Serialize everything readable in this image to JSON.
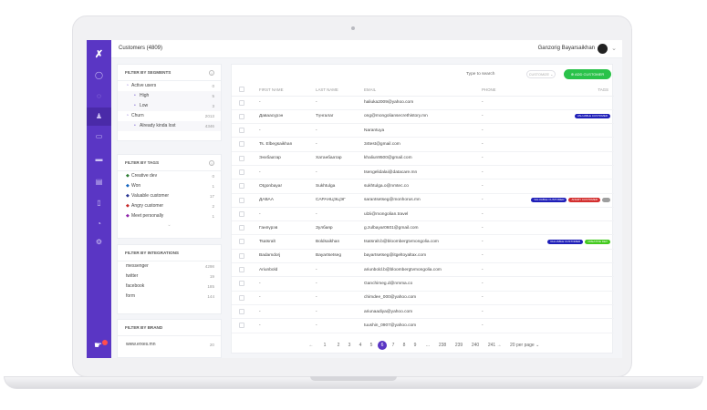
{
  "header": {
    "title": "Customers (4809)",
    "user_name": "Ganzorig Bayarsaikhan"
  },
  "segments": {
    "heading": "FILTER BY SEGMENTS",
    "items": [
      {
        "label": "Active users",
        "count": "0"
      },
      {
        "label": "High",
        "count": "5"
      },
      {
        "label": "Low",
        "count": "3"
      },
      {
        "label": "Churn",
        "count": "2013"
      },
      {
        "label": "Already kinda lost",
        "count": "4346"
      }
    ]
  },
  "tags_filter": {
    "heading": "FILTER BY TAGS",
    "items": [
      {
        "label": "Creative dev",
        "count": "0",
        "color": "#2e7d32"
      },
      {
        "label": "Won",
        "count": "1",
        "color": "#1565c0"
      },
      {
        "label": "Valuable customer",
        "count": "17",
        "color": "#283593"
      },
      {
        "label": "Angry customer",
        "count": "2",
        "color": "#c62828"
      },
      {
        "label": "Meet personally",
        "count": "1",
        "color": "#8e24aa"
      }
    ]
  },
  "integrations": {
    "heading": "FILTER BY INTEGRATIONS",
    "items": [
      {
        "label": "messenger",
        "count": "4298"
      },
      {
        "label": "twitter",
        "count": "19"
      },
      {
        "label": "facebook",
        "count": "185"
      },
      {
        "label": "form",
        "count": "144"
      }
    ]
  },
  "brand": {
    "heading": "FILTER BY BRAND",
    "items": [
      {
        "label": "www.erxes.mn",
        "count": "20"
      }
    ]
  },
  "toolbar": {
    "search_placeholder": "Type to search",
    "customize": "CUSTOMIZE",
    "add_label": "ADD CUSTOMER"
  },
  "table": {
    "headers": {
      "first": "FIRST NAME",
      "last": "LAST NAME",
      "email": "EMAIL",
      "phone": "PHONE",
      "tags": "TAGS"
    },
    "rows": [
      {
        "first": "-",
        "last": "-",
        "email": "haliuka2009@yahoo.com",
        "phone": "-",
        "tags": []
      },
      {
        "first": "Даваасүрэн",
        "last": "Түнгалаг",
        "email": "ong@mongoliansecrethistory.mn",
        "phone": "-",
        "tags": [
          {
            "label": "VALUABLE CUSTOMER",
            "color": "#1e1eb8"
          }
        ]
      },
      {
        "first": "-",
        "last": "-",
        "email": "Narantuya",
        "phone": "-",
        "tags": []
      },
      {
        "first": "Ts. Elbegsaikhan",
        "last": "-",
        "email": "34test@gmail.com",
        "phone": "-",
        "tags": []
      },
      {
        "first": "Энхбаатар",
        "last": "Хатанбаатар",
        "email": "khaliun9500@gmail.com",
        "phone": "-",
        "tags": []
      },
      {
        "first": "-",
        "last": "-",
        "email": "tsengelidalai@datacare.mn",
        "phone": "-",
        "tags": []
      },
      {
        "first": "Otgonbayar",
        "last": "Sukhtulga",
        "email": "sukhtulga.o@nmtec.co",
        "phone": "-",
        "tags": []
      },
      {
        "first": "ДАВАА",
        "last": "САРАНЦЭЦЭГ",
        "email": "sarantsetseg@monhorus.mn",
        "phone": "-",
        "tags": [
          {
            "label": "VALUABLE CUSTOMER",
            "color": "#1e1eb8"
          },
          {
            "label": "ANGRY CUSTOMER",
            "color": "#d32f2f"
          },
          {
            "label": "",
            "color": "#9e9e9e"
          }
        ]
      },
      {
        "first": "-",
        "last": "-",
        "email": "ulzii@mongolian.travel",
        "phone": "-",
        "tags": []
      },
      {
        "first": "Ганпүрэв",
        "last": "Зулбаяр",
        "email": "g.zulbayar0601@gmail.com",
        "phone": "-",
        "tags": []
      },
      {
        "first": "Tsatsralt",
        "last": "Boldsaikhan",
        "email": "tsatsralt.b@bloombergtvmongolia.com",
        "phone": "-",
        "tags": [
          {
            "label": "VALUABLE CUSTOMER",
            "color": "#1e1eb8"
          },
          {
            "label": "CREATIVE DEV",
            "color": "#43c91e"
          }
        ]
      },
      {
        "first": "Badamdorj",
        "last": "Bayartsetseg",
        "email": "bayartsetseg@itgeltoyaltax.com",
        "phone": "-",
        "tags": []
      },
      {
        "first": "Ariunbold",
        "last": "-",
        "email": "ariunbold.b@bloombergtvmongolia.com",
        "phone": "-",
        "tags": []
      },
      {
        "first": "-",
        "last": "-",
        "email": "Ganchimeg.d@nmma.co",
        "phone": "-",
        "tags": []
      },
      {
        "first": "-",
        "last": "-",
        "email": "chimdee_000@yahoo.com",
        "phone": "-",
        "tags": []
      },
      {
        "first": "-",
        "last": "-",
        "email": "ariunaadiya@yahoo.com",
        "phone": "-",
        "tags": []
      },
      {
        "first": "-",
        "last": "-",
        "email": "tuushin_0907@yahoo.com",
        "phone": "-",
        "tags": []
      }
    ]
  },
  "pagination": {
    "prev": "←",
    "next": "→",
    "pages": [
      "1",
      "2",
      "3",
      "4",
      "5",
      "6",
      "7",
      "8",
      "9",
      "...",
      "238",
      "239",
      "240",
      "241"
    ],
    "active": "6",
    "per_page": "20 per page"
  },
  "colors": {
    "sidebar": "#5a36c4",
    "accent": "#2ac24a"
  }
}
